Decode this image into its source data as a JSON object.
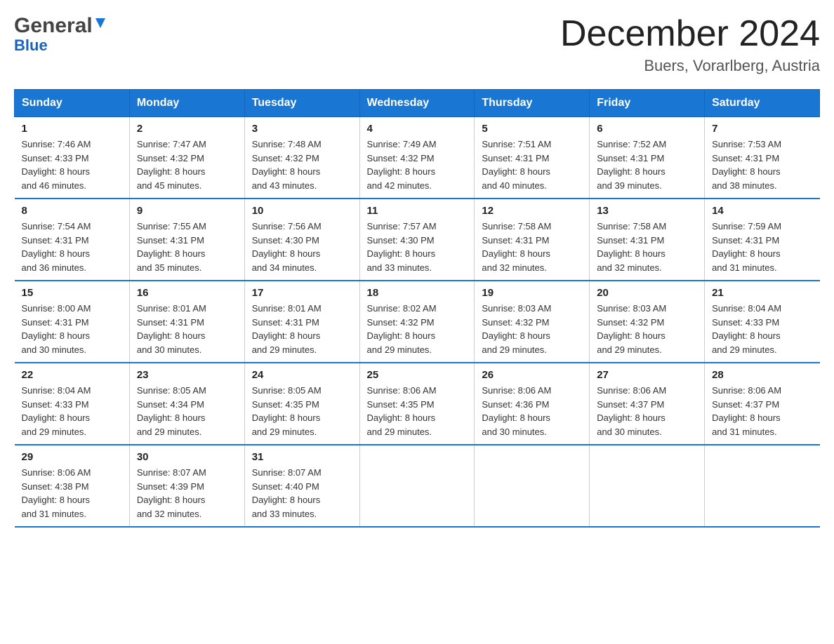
{
  "header": {
    "logo_general": "General",
    "logo_blue": "Blue",
    "month_title": "December 2024",
    "location": "Buers, Vorarlberg, Austria"
  },
  "days_of_week": [
    "Sunday",
    "Monday",
    "Tuesday",
    "Wednesday",
    "Thursday",
    "Friday",
    "Saturday"
  ],
  "weeks": [
    [
      {
        "day": "1",
        "sunrise": "7:46 AM",
        "sunset": "4:33 PM",
        "daylight": "8 hours and 46 minutes."
      },
      {
        "day": "2",
        "sunrise": "7:47 AM",
        "sunset": "4:32 PM",
        "daylight": "8 hours and 45 minutes."
      },
      {
        "day": "3",
        "sunrise": "7:48 AM",
        "sunset": "4:32 PM",
        "daylight": "8 hours and 43 minutes."
      },
      {
        "day": "4",
        "sunrise": "7:49 AM",
        "sunset": "4:32 PM",
        "daylight": "8 hours and 42 minutes."
      },
      {
        "day": "5",
        "sunrise": "7:51 AM",
        "sunset": "4:31 PM",
        "daylight": "8 hours and 40 minutes."
      },
      {
        "day": "6",
        "sunrise": "7:52 AM",
        "sunset": "4:31 PM",
        "daylight": "8 hours and 39 minutes."
      },
      {
        "day": "7",
        "sunrise": "7:53 AM",
        "sunset": "4:31 PM",
        "daylight": "8 hours and 38 minutes."
      }
    ],
    [
      {
        "day": "8",
        "sunrise": "7:54 AM",
        "sunset": "4:31 PM",
        "daylight": "8 hours and 36 minutes."
      },
      {
        "day": "9",
        "sunrise": "7:55 AM",
        "sunset": "4:31 PM",
        "daylight": "8 hours and 35 minutes."
      },
      {
        "day": "10",
        "sunrise": "7:56 AM",
        "sunset": "4:30 PM",
        "daylight": "8 hours and 34 minutes."
      },
      {
        "day": "11",
        "sunrise": "7:57 AM",
        "sunset": "4:30 PM",
        "daylight": "8 hours and 33 minutes."
      },
      {
        "day": "12",
        "sunrise": "7:58 AM",
        "sunset": "4:31 PM",
        "daylight": "8 hours and 32 minutes."
      },
      {
        "day": "13",
        "sunrise": "7:58 AM",
        "sunset": "4:31 PM",
        "daylight": "8 hours and 32 minutes."
      },
      {
        "day": "14",
        "sunrise": "7:59 AM",
        "sunset": "4:31 PM",
        "daylight": "8 hours and 31 minutes."
      }
    ],
    [
      {
        "day": "15",
        "sunrise": "8:00 AM",
        "sunset": "4:31 PM",
        "daylight": "8 hours and 30 minutes."
      },
      {
        "day": "16",
        "sunrise": "8:01 AM",
        "sunset": "4:31 PM",
        "daylight": "8 hours and 30 minutes."
      },
      {
        "day": "17",
        "sunrise": "8:01 AM",
        "sunset": "4:31 PM",
        "daylight": "8 hours and 29 minutes."
      },
      {
        "day": "18",
        "sunrise": "8:02 AM",
        "sunset": "4:32 PM",
        "daylight": "8 hours and 29 minutes."
      },
      {
        "day": "19",
        "sunrise": "8:03 AM",
        "sunset": "4:32 PM",
        "daylight": "8 hours and 29 minutes."
      },
      {
        "day": "20",
        "sunrise": "8:03 AM",
        "sunset": "4:32 PM",
        "daylight": "8 hours and 29 minutes."
      },
      {
        "day": "21",
        "sunrise": "8:04 AM",
        "sunset": "4:33 PM",
        "daylight": "8 hours and 29 minutes."
      }
    ],
    [
      {
        "day": "22",
        "sunrise": "8:04 AM",
        "sunset": "4:33 PM",
        "daylight": "8 hours and 29 minutes."
      },
      {
        "day": "23",
        "sunrise": "8:05 AM",
        "sunset": "4:34 PM",
        "daylight": "8 hours and 29 minutes."
      },
      {
        "day": "24",
        "sunrise": "8:05 AM",
        "sunset": "4:35 PM",
        "daylight": "8 hours and 29 minutes."
      },
      {
        "day": "25",
        "sunrise": "8:06 AM",
        "sunset": "4:35 PM",
        "daylight": "8 hours and 29 minutes."
      },
      {
        "day": "26",
        "sunrise": "8:06 AM",
        "sunset": "4:36 PM",
        "daylight": "8 hours and 30 minutes."
      },
      {
        "day": "27",
        "sunrise": "8:06 AM",
        "sunset": "4:37 PM",
        "daylight": "8 hours and 30 minutes."
      },
      {
        "day": "28",
        "sunrise": "8:06 AM",
        "sunset": "4:37 PM",
        "daylight": "8 hours and 31 minutes."
      }
    ],
    [
      {
        "day": "29",
        "sunrise": "8:06 AM",
        "sunset": "4:38 PM",
        "daylight": "8 hours and 31 minutes."
      },
      {
        "day": "30",
        "sunrise": "8:07 AM",
        "sunset": "4:39 PM",
        "daylight": "8 hours and 32 minutes."
      },
      {
        "day": "31",
        "sunrise": "8:07 AM",
        "sunset": "4:40 PM",
        "daylight": "8 hours and 33 minutes."
      },
      null,
      null,
      null,
      null
    ]
  ],
  "labels": {
    "sunrise": "Sunrise:",
    "sunset": "Sunset:",
    "daylight": "Daylight:"
  }
}
